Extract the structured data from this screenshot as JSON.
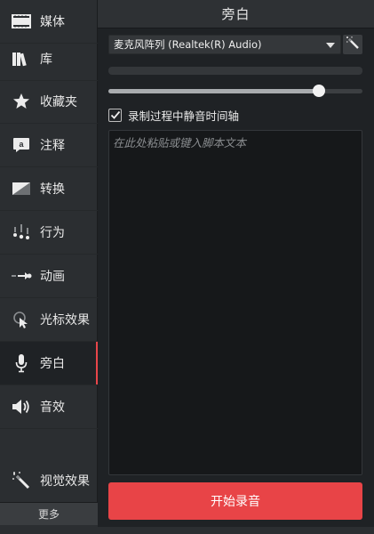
{
  "sidebar": {
    "items": [
      {
        "label": "媒体",
        "icon": "film-icon"
      },
      {
        "label": "库",
        "icon": "library-icon"
      },
      {
        "label": "收藏夹",
        "icon": "star-icon"
      },
      {
        "label": "注释",
        "icon": "annotation-icon"
      },
      {
        "label": "转换",
        "icon": "transition-icon"
      },
      {
        "label": "行为",
        "icon": "behavior-icon"
      },
      {
        "label": "动画",
        "icon": "animation-icon"
      },
      {
        "label": "光标效果",
        "icon": "cursor-effect-icon"
      },
      {
        "label": "旁白",
        "icon": "microphone-icon",
        "active": true
      },
      {
        "label": "音效",
        "icon": "speaker-icon"
      },
      {
        "label": "视觉效果",
        "icon": "magic-wand-icon"
      }
    ],
    "more_label": "更多"
  },
  "panel": {
    "title": "旁白",
    "device_select": "麦克风阵列 (Realtek(R) Audio)",
    "volume_level": 0.83,
    "checkbox_label": "录制过程中静音时间轴",
    "checkbox_checked": true,
    "script_placeholder": "在此处粘贴或键入脚本文本",
    "record_button": "开始录音"
  },
  "colors": {
    "accent": "#e84447",
    "background": "#1f2225",
    "sidebar": "#2b2e31"
  }
}
